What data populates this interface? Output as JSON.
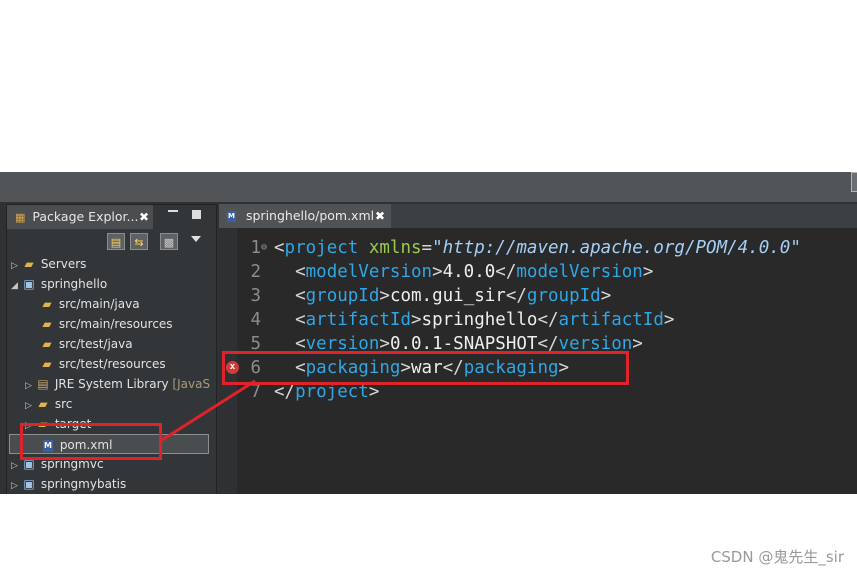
{
  "package_explorer": {
    "tab_label": "Package Explor...",
    "close": "✖",
    "tree": [
      {
        "label": "Servers",
        "kind": "folder",
        "expanded": false,
        "decoration": ""
      },
      {
        "label": "springhello",
        "kind": "project-error",
        "expanded": true,
        "decoration": ""
      },
      {
        "label": "src/main/java",
        "kind": "source",
        "decoration": ""
      },
      {
        "label": "src/main/resources",
        "kind": "source",
        "decoration": ""
      },
      {
        "label": "src/test/java",
        "kind": "source",
        "decoration": ""
      },
      {
        "label": "src/test/resources",
        "kind": "source",
        "decoration": ""
      },
      {
        "label": "JRE System Library",
        "kind": "library",
        "expanded": false,
        "decoration": "[JavaS"
      },
      {
        "label": "src",
        "kind": "folder",
        "expanded": false,
        "decoration": ""
      },
      {
        "label": "target",
        "kind": "folder",
        "expanded": false,
        "decoration": ""
      },
      {
        "label": "pom.xml",
        "kind": "pom-error",
        "selected": true,
        "decoration": ""
      },
      {
        "label": "springmvc",
        "kind": "project",
        "expanded": false,
        "decoration": ""
      },
      {
        "label": "springmybatis",
        "kind": "project",
        "expanded": false,
        "decoration": ""
      }
    ]
  },
  "editor": {
    "tab_label": "springhello/pom.xml",
    "close": "✖",
    "file_icon": "M",
    "lines": [
      {
        "n": "1",
        "tokens": [
          [
            "br",
            "<"
          ],
          [
            "tag",
            "project"
          ],
          [
            "sp",
            " "
          ],
          [
            "attr",
            "xmlns"
          ],
          [
            "eq",
            "="
          ],
          [
            "str",
            "\"http://maven.apache.org/POM/4.0.0\""
          ]
        ]
      },
      {
        "n": "2",
        "tokens": [
          [
            "sp",
            "  "
          ],
          [
            "br",
            "<"
          ],
          [
            "tag",
            "modelVersion"
          ],
          [
            "br",
            ">"
          ],
          [
            "txt",
            "4.0.0"
          ],
          [
            "br",
            "</"
          ],
          [
            "tag",
            "modelVersion"
          ],
          [
            "br",
            ">"
          ]
        ]
      },
      {
        "n": "3",
        "tokens": [
          [
            "sp",
            "  "
          ],
          [
            "br",
            "<"
          ],
          [
            "tag",
            "groupId"
          ],
          [
            "br",
            ">"
          ],
          [
            "txt",
            "com.gui_sir"
          ],
          [
            "br",
            "</"
          ],
          [
            "tag",
            "groupId"
          ],
          [
            "br",
            ">"
          ]
        ]
      },
      {
        "n": "4",
        "tokens": [
          [
            "sp",
            "  "
          ],
          [
            "br",
            "<"
          ],
          [
            "tag",
            "artifactId"
          ],
          [
            "br",
            ">"
          ],
          [
            "txt",
            "springhello"
          ],
          [
            "br",
            "</"
          ],
          [
            "tag",
            "artifactId"
          ],
          [
            "br",
            ">"
          ]
        ]
      },
      {
        "n": "5",
        "tokens": [
          [
            "sp",
            "  "
          ],
          [
            "br",
            "<"
          ],
          [
            "tag",
            "version"
          ],
          [
            "br",
            ">"
          ],
          [
            "txt",
            "0.0.1-SNAPSHOT"
          ],
          [
            "br",
            "</"
          ],
          [
            "tag",
            "version"
          ],
          [
            "br",
            ">"
          ]
        ]
      },
      {
        "n": "6",
        "tokens": [
          [
            "sp",
            "  "
          ],
          [
            "br",
            "<"
          ],
          [
            "tag",
            "packaging"
          ],
          [
            "br",
            ">"
          ],
          [
            "txt",
            "war"
          ],
          [
            "br",
            "</"
          ],
          [
            "tag",
            "packaging"
          ],
          [
            "br",
            ">"
          ]
        ],
        "error": true
      },
      {
        "n": "7",
        "tokens": [
          [
            "br",
            "</"
          ],
          [
            "tag",
            "project"
          ],
          [
            "br",
            ">"
          ]
        ]
      }
    ]
  },
  "icons": {
    "pe_tab": "package-explorer-icon",
    "toolbar": [
      "collapse-all-icon",
      "link-with-editor-icon",
      "view-menu-icon"
    ],
    "error": "error-marker-icon",
    "fold": "fold-minus-icon"
  },
  "colors": {
    "tag": "#2fa6e5",
    "attr": "#9acb4f",
    "string": "#a4cff6",
    "text": "#eeeeee",
    "annotation": "#e0232a",
    "error": "#d33a3a"
  },
  "watermark": "CSDN @鬼先生_sir"
}
